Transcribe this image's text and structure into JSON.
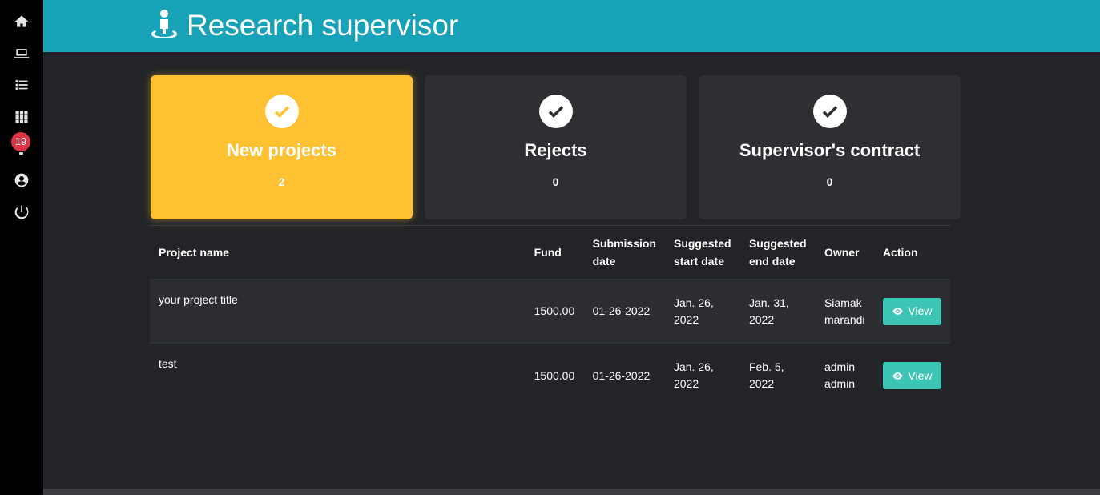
{
  "sidebar": {
    "items": [
      {
        "icon": "home-icon"
      },
      {
        "icon": "laptop-icon"
      },
      {
        "icon": "list-icon"
      },
      {
        "icon": "grid-icon"
      },
      {
        "icon": "bell-icon",
        "badge": "19"
      },
      {
        "icon": "user-circle-icon"
      },
      {
        "icon": "power-icon"
      }
    ],
    "notification_count": "19"
  },
  "header": {
    "title": "Research supervisor",
    "icon": "person-location-icon",
    "color": "#17a2b8"
  },
  "cards": [
    {
      "title": "New projects",
      "count": "2",
      "active": true,
      "icon": "check-circle-icon"
    },
    {
      "title": "Rejects",
      "count": "0",
      "active": false,
      "icon": "check-circle-icon"
    },
    {
      "title": "Supervisor's contract",
      "count": "0",
      "active": false,
      "icon": "check-circle-icon"
    }
  ],
  "table": {
    "headers": {
      "project_name": "Project name",
      "fund": "Fund",
      "submission_line1": "Submission",
      "submission_line2": "date",
      "start_line1": "Suggested",
      "start_line2": "start date",
      "end_line1": "Suggested",
      "end_line2": "end date",
      "owner": "Owner",
      "action": "Action"
    },
    "rows": [
      {
        "project_name": "your project title",
        "fund": "1500.00",
        "submission_date": "01-26-2022",
        "start_line1": "Jan. 26,",
        "start_line2": "2022",
        "end_line1": "Jan. 31,",
        "end_line2": "2022",
        "owner_line1": "Siamak",
        "owner_line2": "marandi",
        "action_label": "View"
      },
      {
        "project_name": "test",
        "fund": "1500.00",
        "submission_date": "01-26-2022",
        "start_line1": "Jan. 26,",
        "start_line2": "2022",
        "end_line1": "Feb. 5,",
        "end_line2": "2022",
        "owner_line1": "admin",
        "owner_line2": "admin",
        "action_label": "View"
      }
    ]
  },
  "colors": {
    "accent_card": "#fec132",
    "view_button": "#3cc5b5",
    "badge": "#dc3545",
    "background": "#222427"
  }
}
